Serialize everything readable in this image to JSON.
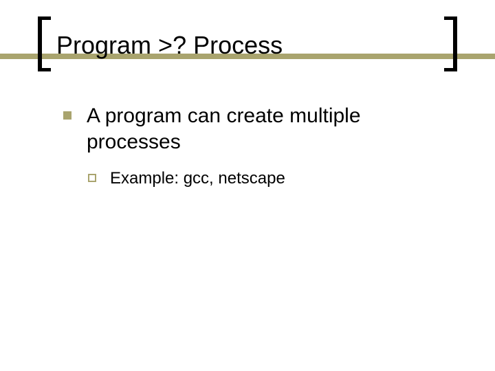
{
  "title": "Program >? Process",
  "points": [
    {
      "text": "A program can create multiple processes",
      "sub": [
        {
          "text": "Example:  gcc, netscape"
        }
      ]
    }
  ],
  "colors": {
    "accent": "#a9a46e",
    "text": "#000000",
    "background": "#ffffff"
  }
}
